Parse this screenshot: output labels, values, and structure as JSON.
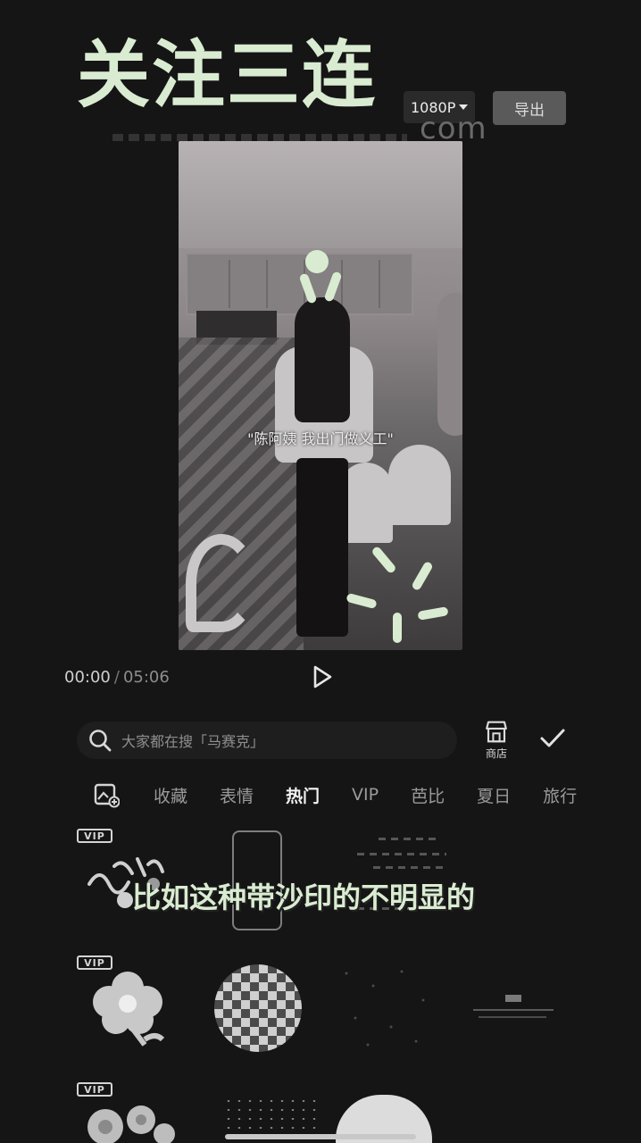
{
  "overlay": {
    "title": "关注三连",
    "watermark": "com"
  },
  "header": {
    "resolution": "1080P",
    "export_label": "导出"
  },
  "preview": {
    "caption": "\"陈阿姨 我出门做义工\""
  },
  "player": {
    "current_time": "00:00",
    "separator": "/",
    "total_time": "05:06"
  },
  "search": {
    "placeholder": "大家都在搜「马赛克」"
  },
  "store": {
    "label": "商店"
  },
  "tabs": [
    {
      "label": "收藏"
    },
    {
      "label": "表情"
    },
    {
      "label": "热门"
    },
    {
      "label": "VIP"
    },
    {
      "label": "芭比"
    },
    {
      "label": "夏日"
    },
    {
      "label": "旅行"
    }
  ],
  "stickers": {
    "vip_badge": "VIP",
    "subtitle": "比如这种带沙印的不明显的"
  },
  "colors": {
    "accent_green": "#d9ecd1",
    "background": "#161516"
  }
}
